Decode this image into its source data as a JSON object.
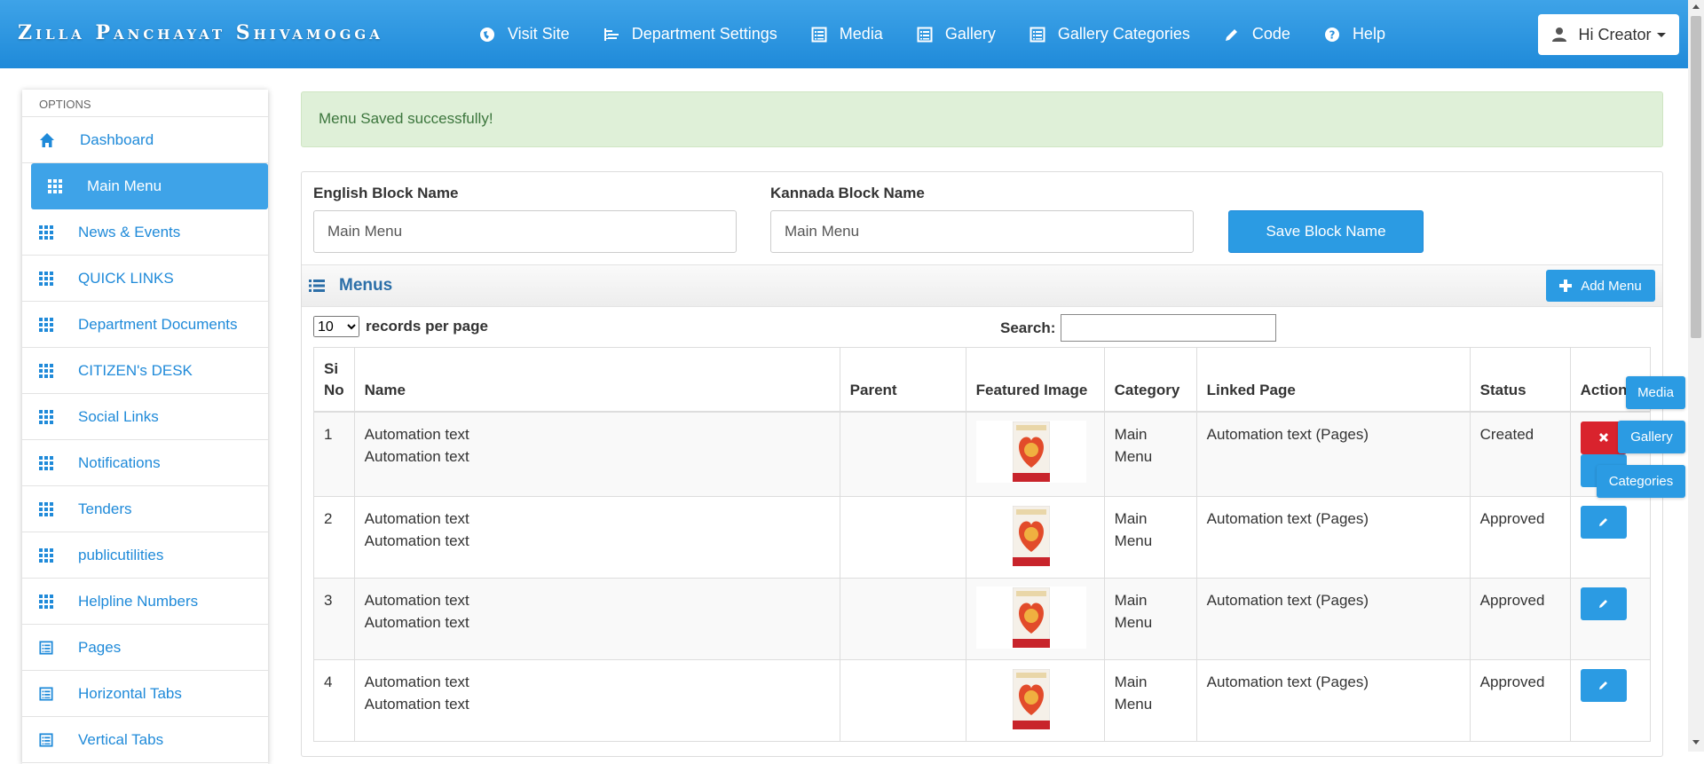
{
  "header": {
    "brand": "Zilla Panchayat Shivamogga",
    "nav": [
      {
        "label": "Visit Site",
        "icon": "globe-icon"
      },
      {
        "label": "Department Settings",
        "icon": "tree-icon"
      },
      {
        "label": "Media",
        "icon": "list-alt-icon"
      },
      {
        "label": "Gallery",
        "icon": "list-alt-icon"
      },
      {
        "label": "Gallery Categories",
        "icon": "list-alt-icon"
      },
      {
        "label": "Code",
        "icon": "pencil-icon"
      },
      {
        "label": "Help",
        "icon": "question-icon"
      }
    ],
    "user_label": "Hi Creator"
  },
  "sidebar": {
    "header": "OPTIONS",
    "items": [
      {
        "label": "Dashboard",
        "icon": "home-icon"
      },
      {
        "label": "Main Menu",
        "icon": "grid-icon",
        "active": true
      },
      {
        "label": "News & Events",
        "icon": "grid-icon"
      },
      {
        "label": "QUICK LINKS",
        "icon": "grid-icon"
      },
      {
        "label": "Department Documents",
        "icon": "grid-icon"
      },
      {
        "label": "CITIZEN's DESK",
        "icon": "grid-icon"
      },
      {
        "label": "Social Links",
        "icon": "grid-icon"
      },
      {
        "label": "Notifications",
        "icon": "grid-icon"
      },
      {
        "label": "Tenders",
        "icon": "grid-icon"
      },
      {
        "label": "publicutilities",
        "icon": "grid-icon"
      },
      {
        "label": "Helpline Numbers",
        "icon": "grid-icon"
      },
      {
        "label": "Pages",
        "icon": "list-alt-icon"
      },
      {
        "label": "Horizontal Tabs",
        "icon": "list-alt-icon"
      },
      {
        "label": "Vertical Tabs",
        "icon": "list-alt-icon"
      }
    ]
  },
  "alert": {
    "message": "Menu Saved successfully!"
  },
  "block_form": {
    "english_label": "English Block Name",
    "english_value": "Main Menu",
    "kannada_label": "Kannada Block Name",
    "kannada_value": "Main Menu",
    "save_label": "Save Block Name"
  },
  "menus": {
    "title": "Menus",
    "add_label": "Add Menu",
    "records_value": "10",
    "records_label": "records per page",
    "search_label": "Search:",
    "columns": [
      "Si No",
      "Name",
      "Parent",
      "Featured Image",
      "Category",
      "Linked Page",
      "Status",
      "Action"
    ],
    "rows": [
      {
        "si": "1",
        "name1": "Automation text",
        "name2": "Automation text",
        "parent": "",
        "cat1": "Main",
        "cat2": "Menu",
        "linked": "Automation text (Pages)",
        "status": "Created"
      },
      {
        "si": "2",
        "name1": "Automation text",
        "name2": "Automation text",
        "parent": "",
        "cat1": "Main",
        "cat2": "Menu",
        "linked": "Automation text (Pages)",
        "status": "Approved"
      },
      {
        "si": "3",
        "name1": "Automation text",
        "name2": "Automation text",
        "parent": "",
        "cat1": "Main",
        "cat2": "Menu",
        "linked": "Automation text (Pages)",
        "status": "Approved"
      },
      {
        "si": "4",
        "name1": "Automation text",
        "name2": "Automation text",
        "parent": "",
        "cat1": "Main",
        "cat2": "Menu",
        "linked": "Automation text (Pages)",
        "status": "Approved"
      }
    ]
  },
  "floating": {
    "media": "Media",
    "gallery": "Gallery",
    "categories": "Categories"
  },
  "colors": {
    "primary": "#2b9be3",
    "danger": "#d9232d",
    "success_bg": "#dff0d8",
    "success_text": "#3c763d"
  }
}
